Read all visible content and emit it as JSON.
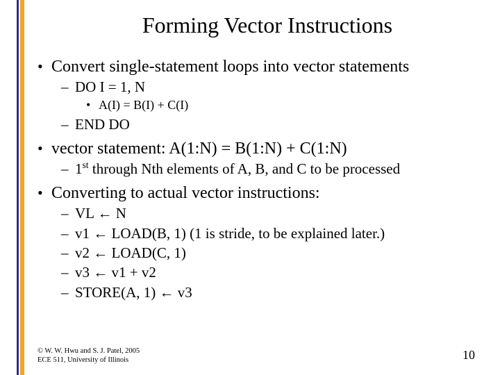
{
  "title": "Forming Vector Instructions",
  "bullets": {
    "b1_1": "Convert single-statement loops into vector statements",
    "b1_1_sub1": "DO I = 1, N",
    "b1_1_sub1_sub1": "A(I) = B(I) + C(I)",
    "b1_1_sub2": "END DO",
    "b1_2": "vector statement: A(1:N) = B(1:N) + C(1:N)",
    "b1_2_sub1_pre": "1",
    "b1_2_sub1_sup": "st",
    "b1_2_sub1_post": " through Nth elements of A, B, and C to be processed",
    "b1_3": "Converting to actual vector instructions:",
    "b1_3_sub1_a": "VL ",
    "b1_3_sub1_b": " N",
    "b1_3_sub2_a": "v1 ",
    "b1_3_sub2_b": " LOAD(B, 1) (1 is stride, to be explained later.)",
    "b1_3_sub3_a": "v2 ",
    "b1_3_sub3_b": " LOAD(C, 1)",
    "b1_3_sub4_a": "v3 ",
    "b1_3_sub4_b": " v1 + v2",
    "b1_3_sub5_a": "STORE(A, 1) ",
    "b1_3_sub5_b": " v3"
  },
  "glyphs": {
    "dot": "•",
    "dash": "–",
    "left_arrow": "←"
  },
  "footer": {
    "line1": "© W. W. Hwu and S. J. Patel, 2005",
    "line2": "ECE 511, University of Illinois",
    "page": "10"
  }
}
